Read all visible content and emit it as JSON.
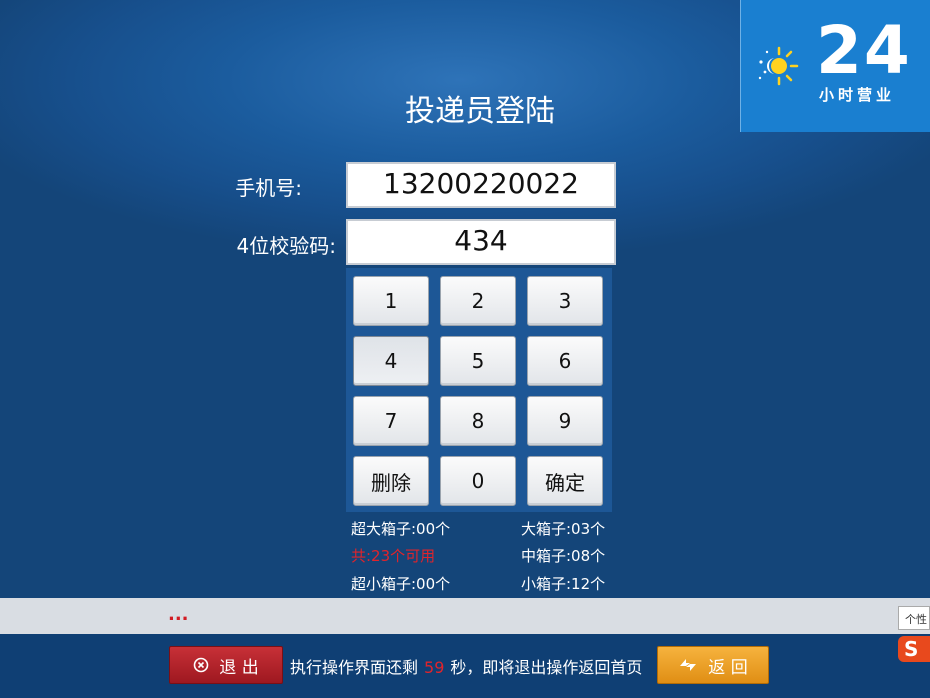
{
  "logo": {
    "big": "24",
    "small": "小时营业"
  },
  "title": "投递员登陆",
  "form": {
    "phone_label": "手机号:",
    "phone_value": "13200220022",
    "code_label": "4位校验码:",
    "code_value": "434"
  },
  "keypad": {
    "keys": [
      "1",
      "2",
      "3",
      "4",
      "5",
      "6",
      "7",
      "8",
      "9",
      "删除",
      "0",
      "确定"
    ]
  },
  "boxes": {
    "xl": "超大箱子:00个",
    "large": "大箱子:03个",
    "total": "共:23个可用",
    "medium": "中箱子:08个",
    "xs": "超小箱子:00个",
    "small": "小箱子:12个"
  },
  "status": {
    "dots": "...",
    "tooltip": "个性"
  },
  "footer": {
    "exit_label": "退 出",
    "countdown_prefix": "执行操作界面还剩",
    "countdown_seconds": "59",
    "countdown_suffix": "秒，即将退出操作返回首页",
    "back_label": "返 回",
    "ime_badge": "S"
  },
  "colors": {
    "accent_red": "#e0242b",
    "exit_red": "#b6252c",
    "back_orange": "#ee9f22",
    "logo_blue": "#1a7fd0"
  }
}
